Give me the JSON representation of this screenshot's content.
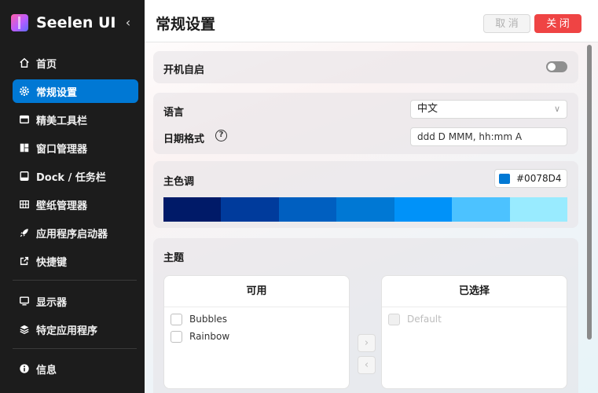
{
  "app": {
    "title": "Seelen UI",
    "collapse_glyph": "‹"
  },
  "sidebar": {
    "items": [
      {
        "label": "首页",
        "icon": "home-icon",
        "active": false
      },
      {
        "label": "常规设置",
        "icon": "gear-icon",
        "active": true
      },
      {
        "label": "精美工具栏",
        "icon": "toolbar-icon",
        "active": false
      },
      {
        "label": "窗口管理器",
        "icon": "window-manager-icon",
        "active": false
      },
      {
        "label": "Dock / 任务栏",
        "icon": "dock-icon",
        "active": false
      },
      {
        "label": "壁纸管理器",
        "icon": "wallpaper-icon",
        "active": false
      },
      {
        "label": "应用程序启动器",
        "icon": "rocket-icon",
        "active": false
      },
      {
        "label": "快捷键",
        "icon": "shortcut-icon",
        "active": false
      },
      {
        "label": "显示器",
        "icon": "monitor-icon",
        "active": false
      },
      {
        "label": "特定应用程序",
        "icon": "layers-icon",
        "active": false
      },
      {
        "label": "信息",
        "icon": "info-icon",
        "active": false
      }
    ]
  },
  "header": {
    "title": "常规设置",
    "cancel_label": "取 消",
    "close_label": "关 闭"
  },
  "settings": {
    "autostart": {
      "label": "开机自启",
      "enabled": false
    },
    "language": {
      "label": "语言",
      "value": "中文"
    },
    "date_format": {
      "label": "日期格式",
      "help": "?",
      "value": "ddd D MMM, hh:mm A"
    },
    "accent": {
      "label": "主色调",
      "hex": "#0078D4",
      "palette": [
        "#001a68",
        "#003b9c",
        "#005fc0",
        "#0078d4",
        "#0092f9",
        "#4cc2ff",
        "#99ebff"
      ]
    },
    "theme": {
      "label": "主题",
      "available_title": "可用",
      "selected_title": "已选择",
      "available": [
        "Bubbles",
        "Rainbow"
      ],
      "selected": [
        "Default"
      ],
      "move_right": "›",
      "move_left": "‹"
    }
  },
  "colors": {
    "accent": "#0078D4",
    "close": "#ef4444",
    "sidebar_bg": "#1c1c1c"
  }
}
